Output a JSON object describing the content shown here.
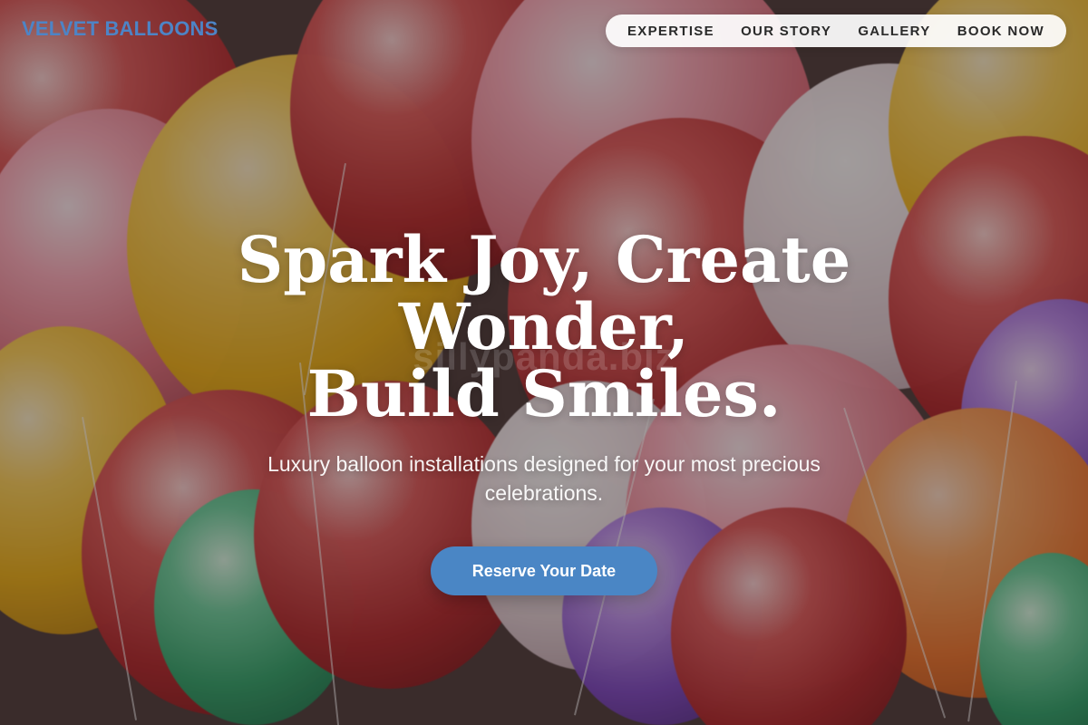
{
  "header": {
    "brand": "VELVET BALLOONS",
    "nav": [
      {
        "label": "EXPERTISE"
      },
      {
        "label": "OUR STORY"
      },
      {
        "label": "GALLERY"
      },
      {
        "label": "BOOK NOW"
      }
    ]
  },
  "hero": {
    "headline_line1": "Spark Joy, Create Wonder,",
    "headline_line2": "Build Smiles.",
    "subhead_line1": "Luxury balloon installations designed for your most precious",
    "subhead_line2": "celebrations.",
    "cta_label": "Reserve Your Date",
    "watermark": "sillypanda.biz"
  },
  "colors": {
    "brand": "#4d84c6",
    "cta": "#4a86c5"
  }
}
